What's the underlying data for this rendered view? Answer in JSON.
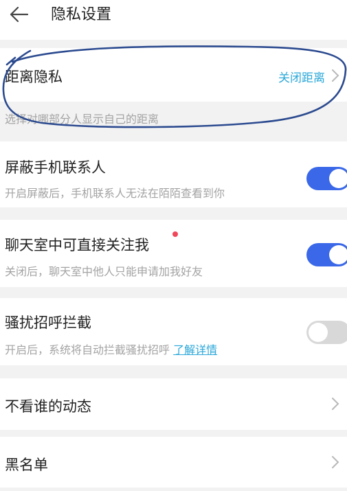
{
  "header": {
    "title": "隐私设置",
    "back_icon": "arrow-left-icon"
  },
  "distance": {
    "label": "距离隐私",
    "value": "关闭距离",
    "description": "选择对哪部分人显示自己的距离"
  },
  "settings": [
    {
      "label": "屏蔽手机联系人",
      "description": "开启屏蔽后，手机联系人无法在陌陌查看到你",
      "enabled": true
    },
    {
      "label": "聊天室中可直接关注我",
      "description": "关闭后，聊天室中他人只能申请加我好友",
      "enabled": true,
      "has_red_dot": true
    },
    {
      "label": "骚扰招呼拦截",
      "description": "开启后，系统将自动拦截骚扰招呼",
      "link": "了解详情",
      "enabled": false
    }
  ],
  "nav_rows": [
    {
      "label": "不看谁的动态"
    },
    {
      "label": "黑名单"
    }
  ],
  "colors": {
    "accent": "#3a68e8",
    "link": "#2aa7d8",
    "annotation": "#2b4a8f",
    "red_dot": "#f0475a"
  }
}
